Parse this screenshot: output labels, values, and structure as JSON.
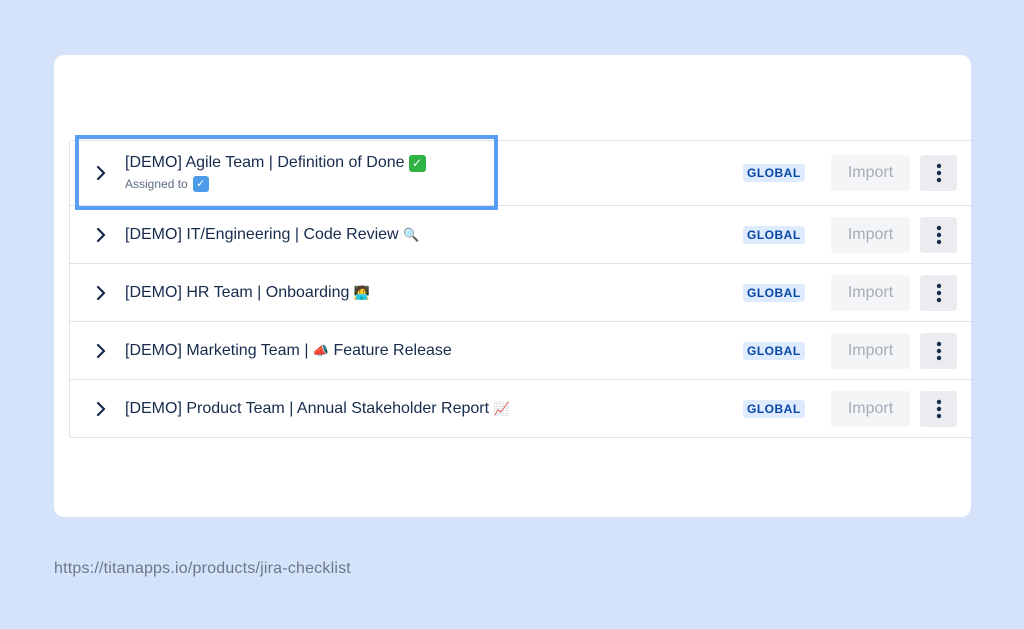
{
  "rows": [
    {
      "title": "[DEMO] Agile Team | Definition of Done",
      "emoji": "✓",
      "emoji_icon": "check-mark-icon",
      "subtitle": "Assigned to",
      "subtitle_emoji": "✓",
      "badge": "GLOBAL",
      "import_label": "Import"
    },
    {
      "title": "[DEMO] IT/Engineering | Code Review",
      "emoji": "🔍",
      "emoji_icon": "magnifier-icon",
      "badge": "GLOBAL",
      "import_label": "Import"
    },
    {
      "title": "[DEMO] HR Team | Onboarding",
      "emoji": "🧑‍💻",
      "emoji_icon": "technologist-icon",
      "badge": "GLOBAL",
      "import_label": "Import"
    },
    {
      "title_prefix": "[DEMO] Marketing Team |",
      "emoji": "📣",
      "emoji_icon": "megaphone-icon",
      "title_suffix": "Feature Release",
      "badge": "GLOBAL",
      "import_label": "Import"
    },
    {
      "title": "[DEMO] Product Team | Annual Stakeholder Report",
      "emoji": "📈",
      "emoji_icon": "chart-increasing-icon",
      "badge": "GLOBAL",
      "import_label": "Import"
    }
  ],
  "footer": {
    "url": "https://titanapps.io/products/jira-checklist"
  },
  "colors": {
    "background": "#d4e3f9",
    "highlight": "#5b9cf5",
    "badge_bg": "#deebff",
    "badge_text": "#0747a6"
  }
}
